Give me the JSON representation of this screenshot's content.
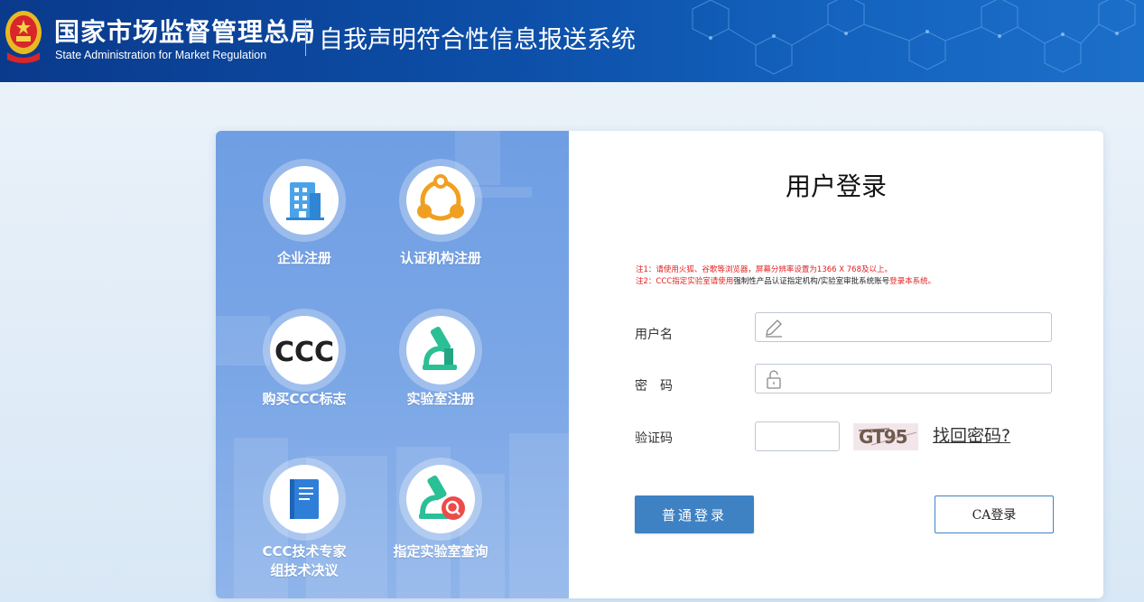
{
  "header": {
    "org_name_cn": "国家市场监督管理总局",
    "org_name_en": "State Administration  for  Market Regulation",
    "system_title": "自我声明符合性信息报送系统"
  },
  "tiles": [
    {
      "label": "企业注册",
      "icon": "office-building-icon"
    },
    {
      "label": "认证机构注册",
      "icon": "share-network-icon"
    },
    {
      "label": "购买CCC标志",
      "icon": "ccc-mark-icon",
      "icon_text": "CCC"
    },
    {
      "label": "实验室注册",
      "icon": "microscope-icon"
    },
    {
      "label": "CCC技术专家",
      "label2": "组技术决议",
      "icon": "book-icon"
    },
    {
      "label": "指定实验室查询",
      "icon": "microscope-search-icon"
    }
  ],
  "login": {
    "title": "用户登录",
    "note1": "注1：请使用火狐、谷歌等浏览器，屏幕分辨率设置为1366 X 768及以上。",
    "note2_prefix": "注2：CCC指定实验室请使用",
    "note2_middle": "强制性产品认证指定机构/实验室审批系统账号",
    "note2_suffix": "登录本系统。",
    "username_label": "用户名",
    "username_value": "",
    "password_label": "密　码",
    "password_value": "",
    "captcha_label": "验证码",
    "captcha_value": "",
    "captcha_image_text": "GT95",
    "forgot_password": "找回密码?",
    "normal_login": "普通登录",
    "ca_login": "CA登录"
  },
  "colors": {
    "header_blue": "#0d4fa8",
    "panel_blue": "#7aa6e6",
    "button_blue": "#3e82c4",
    "note_red": "#e02020"
  }
}
